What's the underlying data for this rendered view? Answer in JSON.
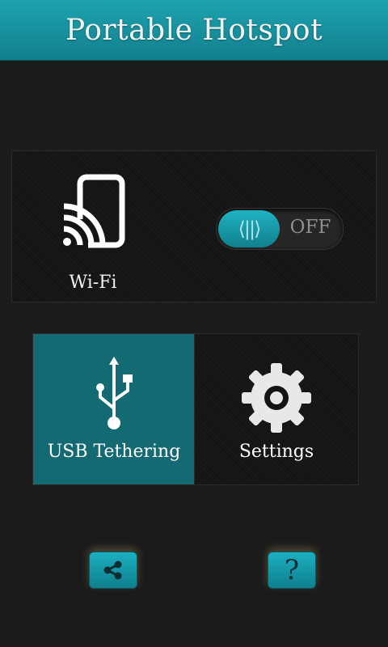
{
  "header": {
    "title": "Portable Hotspot"
  },
  "wifi": {
    "label": "Wi-Fi",
    "toggle_state": "OFF"
  },
  "tiles": [
    {
      "label": "USB Tethering",
      "icon": "usb-icon",
      "active": true
    },
    {
      "label": "Settings",
      "icon": "gear-icon",
      "active": false
    }
  ],
  "bottom_buttons": [
    {
      "icon": "share-icon"
    },
    {
      "icon": "help-icon",
      "glyph": "?"
    }
  ],
  "colors": {
    "header": "#1ea3b0",
    "accent": "#136a72",
    "background": "#1b1b1b"
  }
}
